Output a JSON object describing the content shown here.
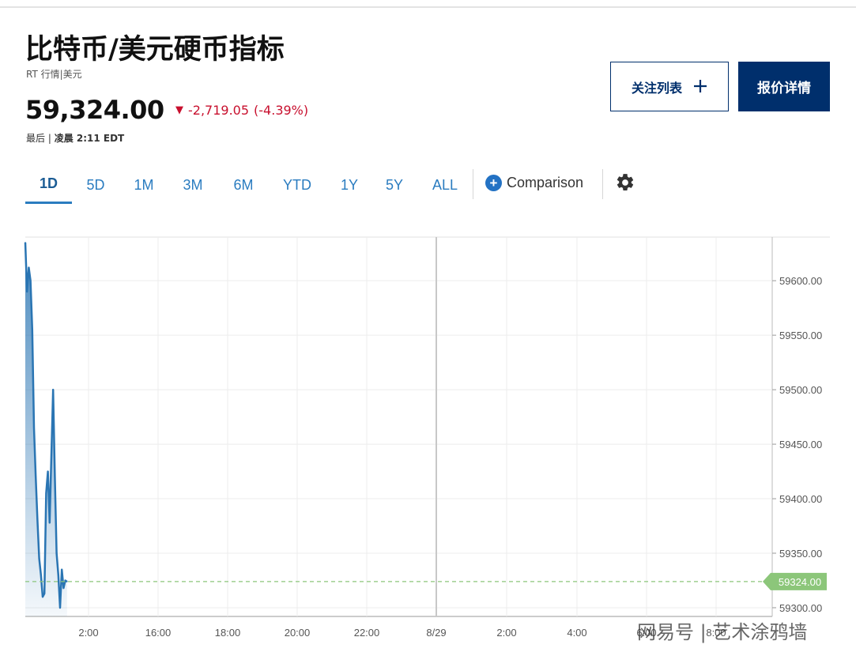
{
  "header": {
    "title": "比特币/美元硬币指标",
    "subtitle": "RT 行情|美元",
    "price": "59,324.00",
    "change_arrow": "▼",
    "change": "-2,719.05",
    "change_pct": "(-4.39%)",
    "last_label": "最后 | ",
    "last_time": "凌晨 2:11 EDT"
  },
  "buttons": {
    "watchlist": "关注列表",
    "watchlist_icon": "plus-icon",
    "quote_details": "报价详情"
  },
  "tabs": [
    {
      "label": "1D",
      "active": true
    },
    {
      "label": "5D"
    },
    {
      "label": "1M"
    },
    {
      "label": "3M"
    },
    {
      "label": "6M"
    },
    {
      "label": "YTD"
    },
    {
      "label": "1Y"
    },
    {
      "label": "5Y"
    },
    {
      "label": "ALL"
    }
  ],
  "comparison": {
    "label": "Comparison",
    "icon": "plus-circle-icon"
  },
  "settings": {
    "icon": "gear-icon"
  },
  "colors": {
    "line": "#2a75b3",
    "negative": "#c8102e",
    "navy": "#002f6c",
    "tab": "#2a7cc0",
    "current_label_bg": "#8cc67a"
  },
  "chart_data": {
    "type": "area",
    "x_tick_labels": [
      "2:00",
      "16:00",
      "18:00",
      "20:00",
      "22:00",
      "8/29",
      "2:00",
      "4:00",
      "6:00",
      "8:00"
    ],
    "y_tick_labels": [
      "59600.00",
      "59550.00",
      "59500.00",
      "59450.00",
      "59400.00",
      "59350.00",
      "59300.00"
    ],
    "ylim": [
      59292,
      59640
    ],
    "current_value": 59324.0,
    "current_label": "59324.00",
    "series": [
      {
        "time_hours": [
          0.0,
          0.05,
          0.1,
          0.15,
          0.2,
          0.25,
          0.3,
          0.35,
          0.4,
          0.45,
          0.5,
          0.55,
          0.6,
          0.65,
          0.7,
          0.75,
          0.8,
          0.85,
          0.9,
          0.95,
          1.0,
          1.05,
          1.1,
          1.15,
          1.2
        ],
        "values": [
          59635,
          59590,
          59612,
          59600,
          59555,
          59465,
          59420,
          59380,
          59345,
          59330,
          59310,
          59313,
          59405,
          59425,
          59378,
          59440,
          59500,
          59420,
          59350,
          59330,
          59300,
          59335,
          59318,
          59325,
          59324
        ]
      }
    ],
    "grid": true,
    "dashed_current_line": true
  },
  "watermark": "网易号 | 艺术涂鸦墙"
}
